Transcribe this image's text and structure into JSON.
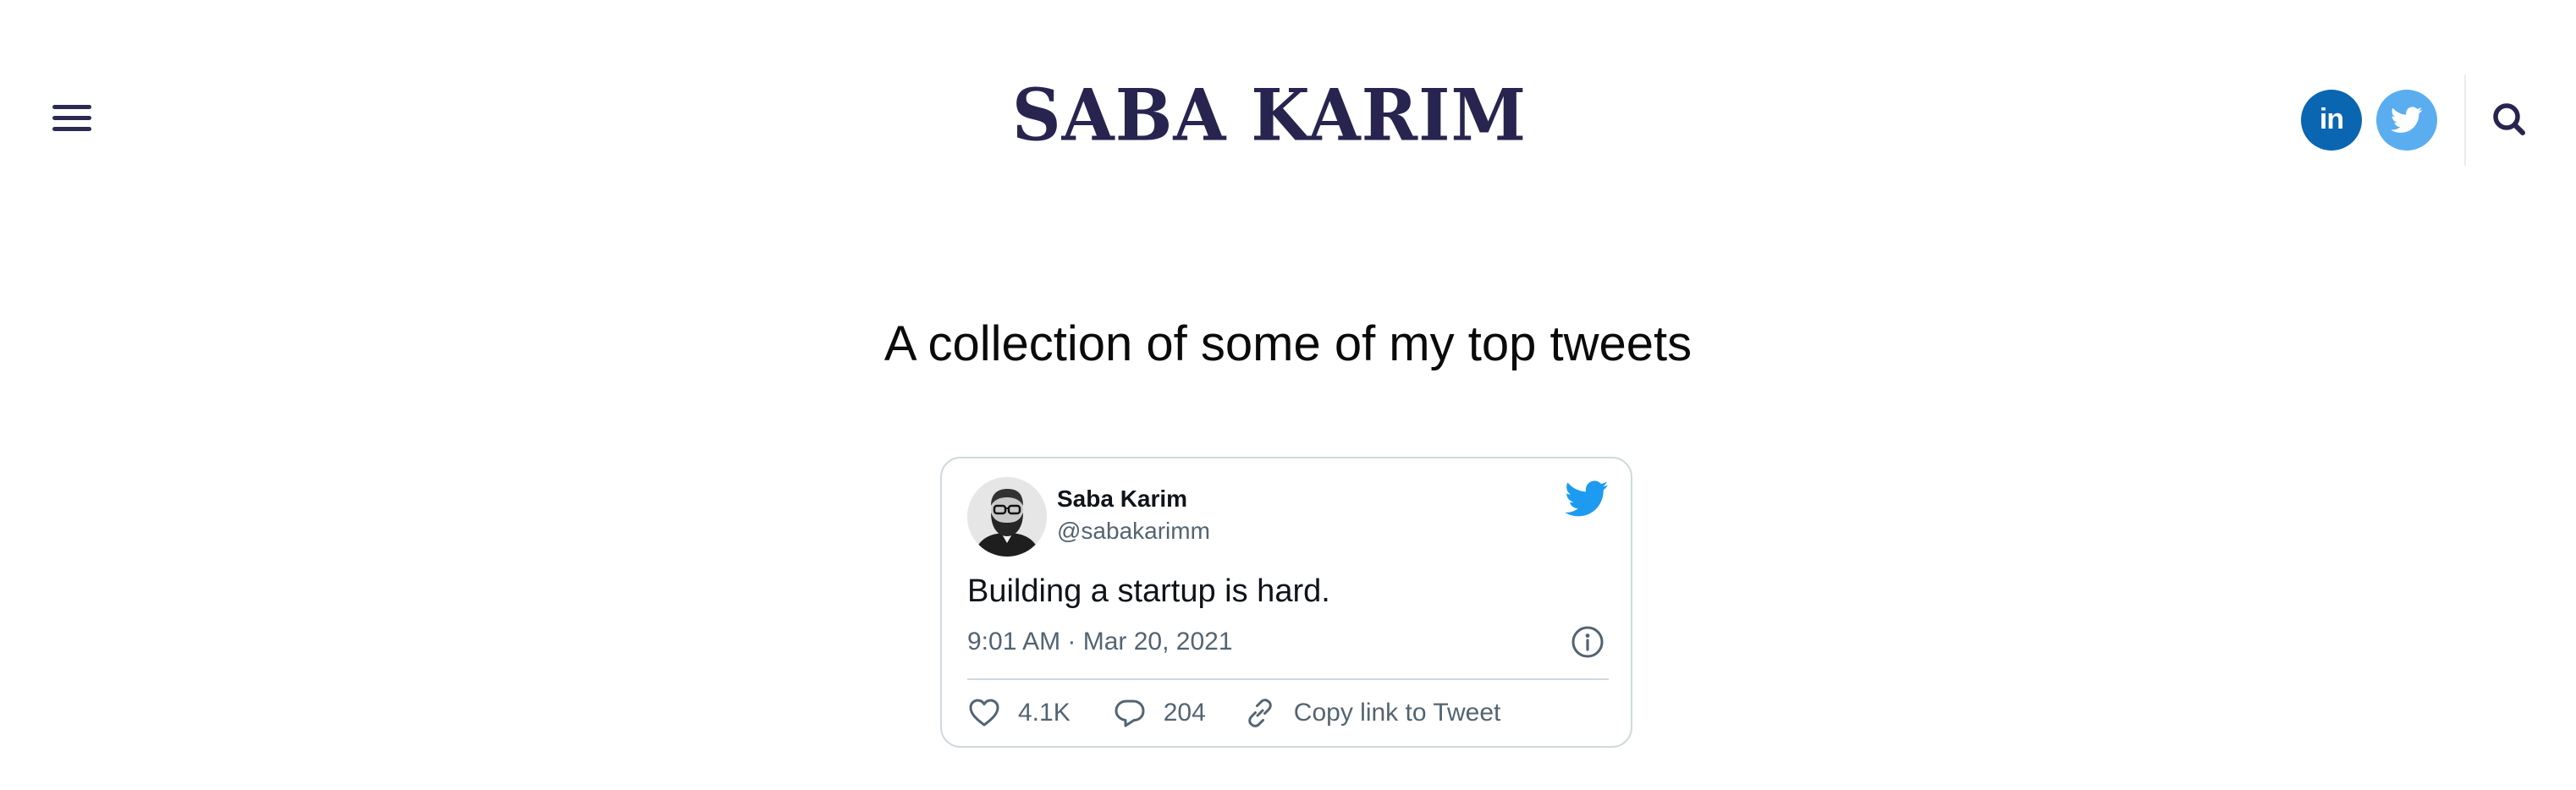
{
  "header": {
    "site_title": "SABA KARIM",
    "menu_icon": "hamburger-menu-icon",
    "social": [
      {
        "name": "LinkedIn",
        "icon": "linkedin-icon",
        "label": "in",
        "color": "#0a66b0"
      },
      {
        "name": "Twitter",
        "icon": "twitter-icon",
        "color": "#5aaef0"
      }
    ],
    "search_icon": "search-icon",
    "title_color": "#27254f"
  },
  "main": {
    "heading": "A collection of some of my top tweets"
  },
  "tweet": {
    "author_name": "Saba Karim",
    "author_handle": "@sabakarimm",
    "text": "Building a startup is hard.",
    "timestamp": "9:01 AM · Mar 20, 2021",
    "likes": "4.1K",
    "replies": "204",
    "copy_link_label": "Copy link to Tweet",
    "brand_color": "#1d9bf0",
    "muted_color": "#536471"
  }
}
